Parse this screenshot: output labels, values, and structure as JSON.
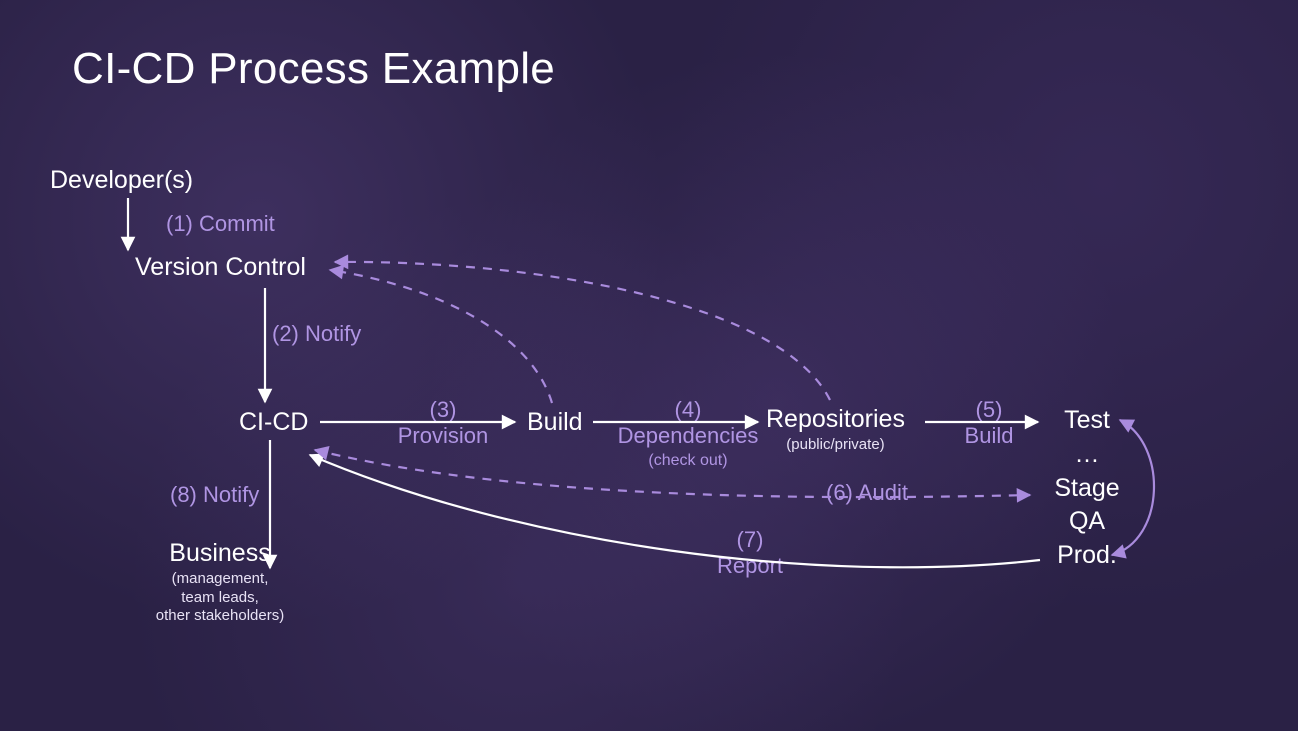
{
  "title": "CI-CD Process Example",
  "nodes": {
    "developers": "Developer(s)",
    "version_control": "Version Control",
    "cicd": "CI-CD",
    "build": "Build",
    "repositories": {
      "label": "Repositories",
      "sub": "(public/private)"
    },
    "business": {
      "label": "Business",
      "sub": "(management,\nteam leads,\nother stakeholders)"
    },
    "environments": {
      "test": "Test",
      "dots": "…",
      "stage": "Stage",
      "qa": "QA",
      "prod": "Prod."
    }
  },
  "edges": {
    "commit": {
      "num": "(1)",
      "label": "Commit"
    },
    "notify_vc": {
      "num": "(2)",
      "label": "Notify"
    },
    "provision": {
      "num": "(3)",
      "label": "Provision"
    },
    "deps": {
      "num": "(4)",
      "label": "Dependencies",
      "sub": "(check out)"
    },
    "build": {
      "num": "(5)",
      "label": "Build"
    },
    "audit": {
      "num": "(6)",
      "label": "Audit"
    },
    "report": {
      "num": "(7)",
      "label": "Report"
    },
    "notify_biz": {
      "num": "(8)",
      "label": "Notify"
    }
  },
  "colors": {
    "accent": "#b095e3",
    "line_white": "#ffffff",
    "line_accent": "#a98bdd"
  }
}
